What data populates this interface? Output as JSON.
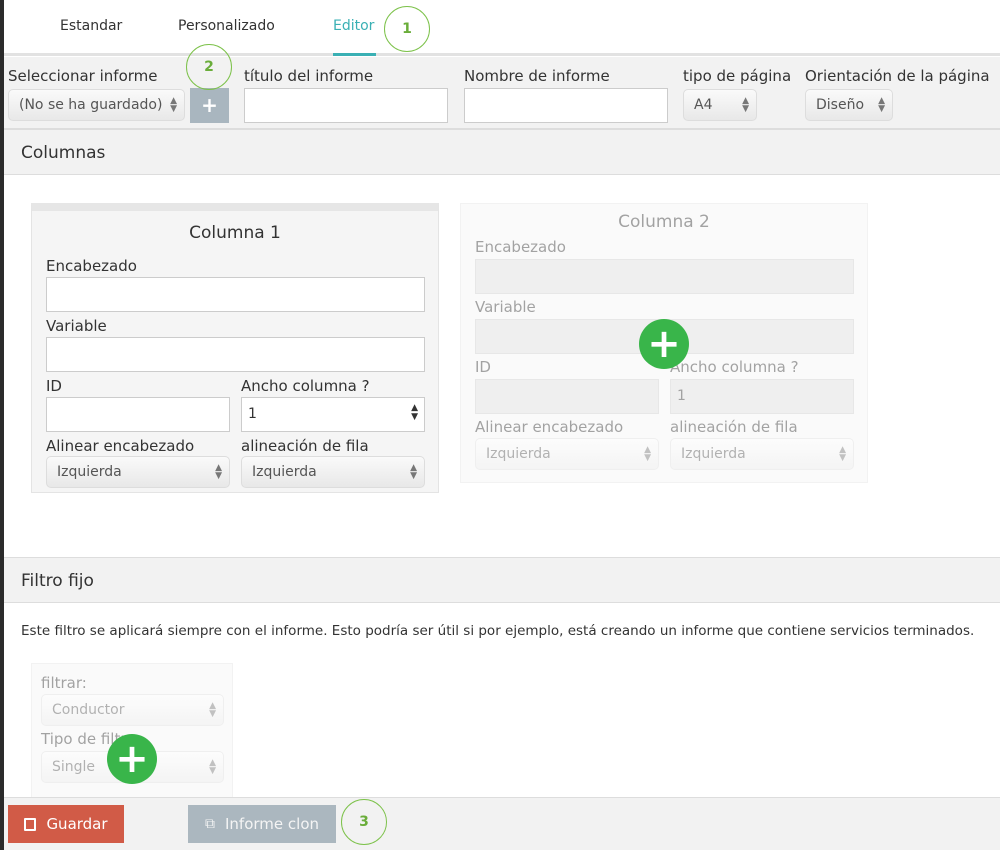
{
  "tabs": [
    {
      "label": "Estandar"
    },
    {
      "label": "Personalizado"
    },
    {
      "label": "Editor"
    }
  ],
  "annotations": [
    "1",
    "2",
    "3"
  ],
  "toolbar": {
    "select_report_label": "Seleccionar informe",
    "select_report_value": "(No se ha guardado)",
    "add_label": "+",
    "report_title_label": "título del informe",
    "report_title_value": "",
    "report_name_label": "Nombre de informe",
    "report_name_value": "",
    "page_type_label": "tipo de página",
    "page_type_value": "A4",
    "orientation_label": "Orientación de la página",
    "orientation_value": "Diseño"
  },
  "columns": {
    "title": "Columnas",
    "items": [
      {
        "title": "Columna 1",
        "header_label": "Encabezado",
        "header_value": "",
        "variable_label": "Variable",
        "variable_value": "",
        "id_label": "ID",
        "id_value": "",
        "width_label": "Ancho columna ?",
        "width_value": "1",
        "align_header_label": "Alinear encabezado",
        "align_header_value": "Izquierda",
        "row_align_label": "alineación de fila",
        "row_align_value": "Izquierda"
      },
      {
        "title": "Columna 2",
        "header_label": "Encabezado",
        "header_value": "",
        "variable_label": "Variable",
        "variable_value": "",
        "id_label": "ID",
        "id_value": "",
        "width_label": "Ancho columna ?",
        "width_value": "1",
        "align_header_label": "Alinear encabezado",
        "align_header_value": "Izquierda",
        "row_align_label": "alineación de fila",
        "row_align_value": "Izquierda"
      }
    ]
  },
  "filter": {
    "title": "Filtro fijo",
    "description": "Este filtro se aplicará siempre con el informe. Esto podría ser útil si por ejemplo, está creando un informe que contiene servicios terminados.",
    "filter_label": "filtrar:",
    "filter_value": "Conductor",
    "type_label": "Tipo de filtro",
    "type_value": "Single"
  },
  "footer": {
    "save_label": "Guardar",
    "clone_label": "Informe clon"
  },
  "colors": {
    "accent": "#3ab0b4",
    "save": "#d15b47",
    "annotation": "#7dc24b",
    "add": "#39b54a"
  }
}
